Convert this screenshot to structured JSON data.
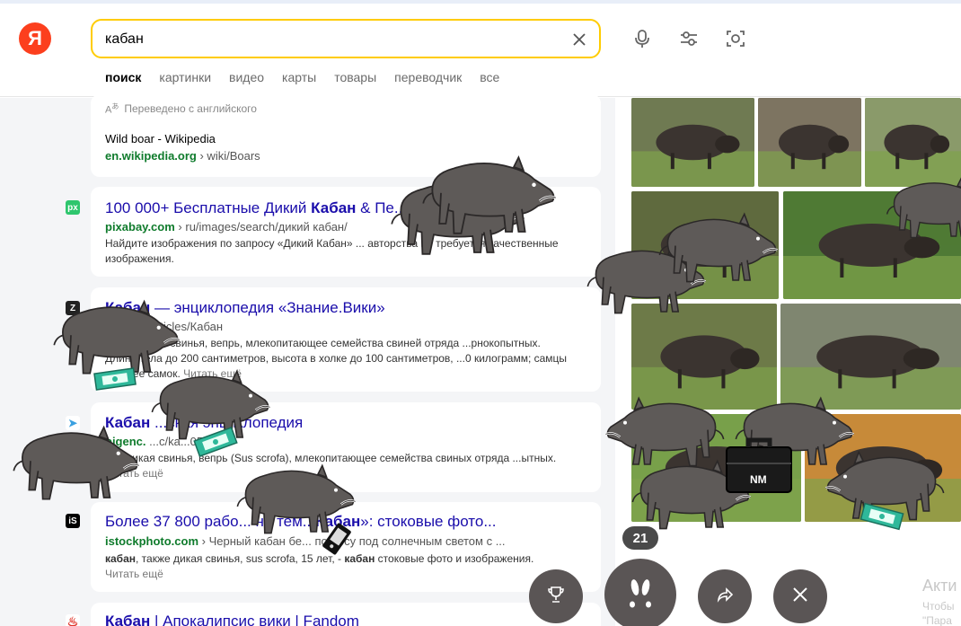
{
  "header": {
    "logo": "Я",
    "search_value": "кабан",
    "tabs": [
      "поиск",
      "картинки",
      "видео",
      "карты",
      "товары",
      "переводчик",
      "все"
    ]
  },
  "results": [
    {
      "translated": "Переведено с английского",
      "title": "Wild boar - Wikipedia",
      "domain": "en.wikipedia.org",
      "path": "› wiki/Boars"
    },
    {
      "favicon": "px",
      "title_pre": "100 000+ Бесплатные Дикий ",
      "title_bold": "Кабан",
      "title_post": " & Пе...ия",
      "domain": "pixabay.com",
      "path": "› ru/images/search/дикий кабан/",
      "snippet": "Найдите изображения по запросу «Дикий Кабан» ... авторства не требуется качественные изображения."
    },
    {
      "favicon": "Z",
      "title_pre": "",
      "title_bold": "Кабан",
      "title_post": " — энциклопедия «Знание.Вики»",
      "domain": "...ia.ru",
      "path": "› articles/Кабан",
      "snippet": "...ное, дикая свинья, вепрь, млекопитающее семейства свиней отряда ...рнокопытных. Длина тела до 200 сантиметров, высота в холке до 100 сантиметров, ...0 килограмм; самцы крупнее самок.",
      "more": "Читать ещё"
    },
    {
      "favicon": "➤",
      "title_pre": "",
      "title_bold": "Кабан",
      "title_post": " ...ская энциклопедия",
      "domain": "bigenc.",
      "path": "...c/ka...0585",
      "snippet": "...н, дикая свинья, вепрь (Sus scrofa), млекопитающее семейства свиных отряда ...ытных.",
      "more": "Читать ещё"
    },
    {
      "favicon": "iS",
      "title_pre": "Более 37 800 рабо... на тем...",
      "title_bold": "Кабан",
      "title_post": "»: стоковые фото...",
      "domain": "istockphoto.com",
      "path": "› Черный кабан бе... по лесу под солнечным светом с ...",
      "snippet_b1": "кабан",
      "snippet_mid": ", также дикая свинья, sus scrofa, 15 лет, - ",
      "snippet_b2": "кабан",
      "snippet_end": " стоковые фото и изображения.",
      "more": "Читать ещё"
    },
    {
      "title_pre": "",
      "title_bold": "Кабан",
      "title_post": " | Апокалипсис вики | Fandom"
    }
  ],
  "game": {
    "counter": "21",
    "briefcase_label": "NM"
  },
  "watermark": {
    "line1": "Акти",
    "line2": "Чтобы",
    "line3": "\"Пара"
  },
  "icons": [
    "clear-icon",
    "microphone-icon",
    "filters-icon",
    "camera-icon",
    "translate-icon",
    "trophy-icon",
    "paw-icon",
    "share-icon",
    "close-icon"
  ],
  "colors": {
    "accent": "#ffcc00",
    "logo": "#fc3f1d",
    "link": "#1a0dab",
    "url": "#0f7b2c",
    "boar": "#5e5a58"
  }
}
